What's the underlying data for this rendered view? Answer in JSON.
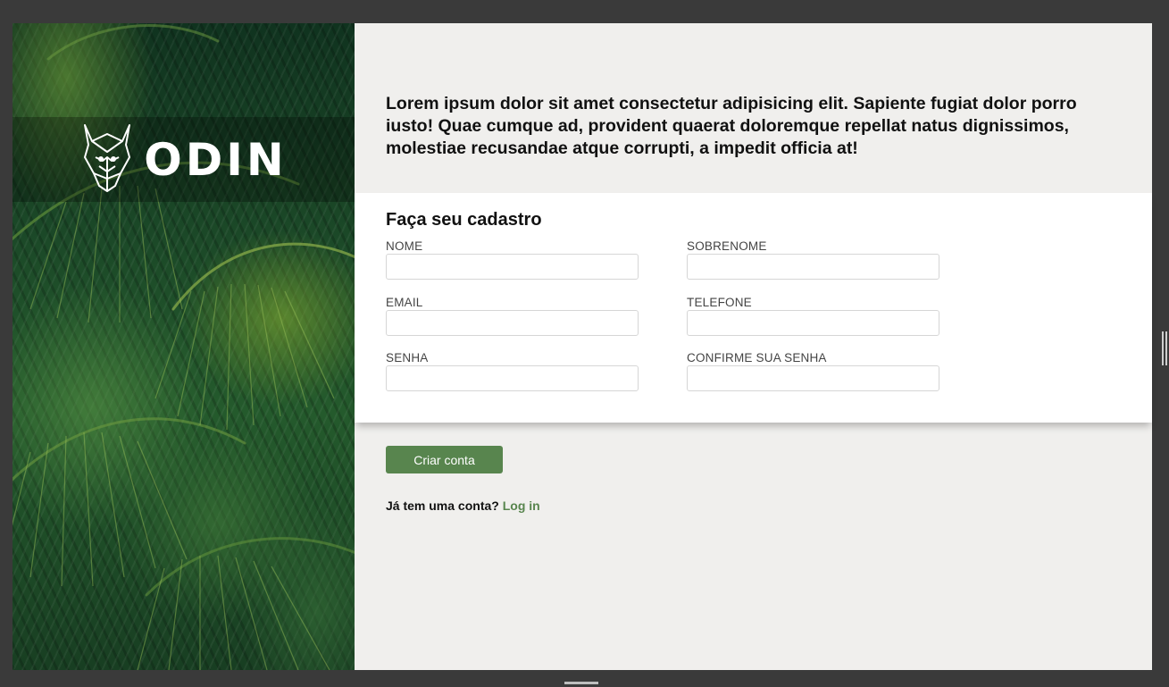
{
  "brand": {
    "name": "ODIN",
    "logo_icon": "viking-helmet-icon"
  },
  "intro_text": "Lorem ipsum dolor sit amet consectetur adipisicing elit. Sapiente fugiat dolor porro iusto! Quae cumque ad, provident quaerat doloremque repellat natus dignissimos, molestiae recusandae atque corrupti, a impedit officia at!",
  "form": {
    "title": "Faça seu cadastro",
    "fields": {
      "nome": {
        "label": "NOME",
        "value": ""
      },
      "sobrenome": {
        "label": "SOBRENOME",
        "value": ""
      },
      "email": {
        "label": "EMAIL",
        "value": ""
      },
      "telefone": {
        "label": "TELEFONE",
        "value": ""
      },
      "senha": {
        "label": "SENHA",
        "value": ""
      },
      "confirme_senha": {
        "label": "CONFIRME SUA SENHA",
        "value": ""
      }
    },
    "submit_label": "Criar conta"
  },
  "login": {
    "prompt": "Já tem uma conta?",
    "link_label": "Log in"
  },
  "colors": {
    "accent": "#58854e",
    "background": "#f0efed",
    "card": "#ffffff",
    "frame": "#3a3a3a"
  }
}
